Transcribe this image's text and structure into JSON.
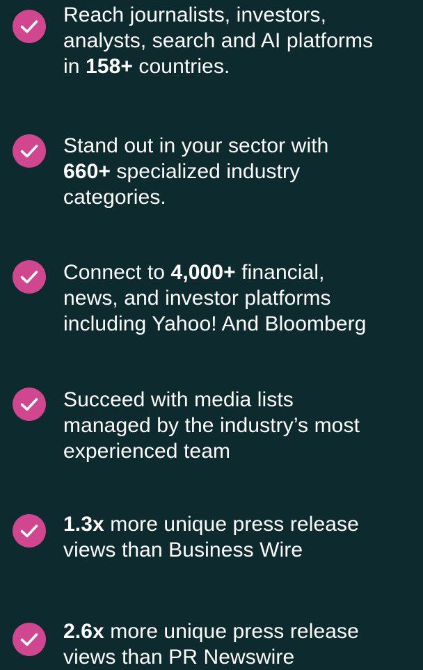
{
  "colors": {
    "background": "#0d2b2f",
    "check_fill": "#d0468f",
    "text": "#ffffff"
  },
  "icon": "check-circle-icon",
  "items": [
    {
      "line1": "Reach journalists, investors,",
      "line2": "analysts, search and AI platforms",
      "line3_pre": "in ",
      "line3_bold": "158+",
      "line3_post": " countries."
    },
    {
      "line1": "Stand out in your sector with",
      "line2_bold": "660+",
      "line2_post": " specialized industry",
      "line3": "categories."
    },
    {
      "line1_pre": "Connect to ",
      "line1_bold": "4,000+",
      "line1_post": " financial,",
      "line2": "news, and investor platforms",
      "line3": "including Yahoo! And Bloomberg"
    },
    {
      "line1": "Succeed with media lists",
      "line2": "managed by the industry’s most",
      "line3": "experienced team"
    },
    {
      "line1_bold": "1.3x",
      "line1_post": " more unique press release",
      "line2": "views than Business Wire"
    },
    {
      "line1_bold": "2.6x",
      "line1_post": " more unique press release",
      "line2": "views than PR Newswire"
    }
  ]
}
